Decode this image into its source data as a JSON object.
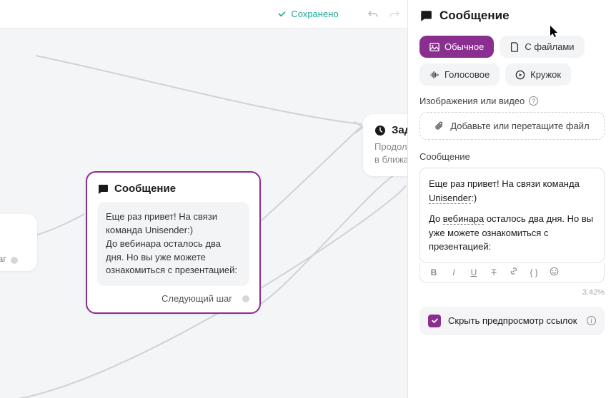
{
  "topbar": {
    "save_status": "Сохранено"
  },
  "canvas": {
    "left_node": "й шаг",
    "message_card": {
      "title": "Сообщение",
      "body_line1": "Еще раз привет! На связи команда Unisender:)",
      "body_line2": "До вебинара осталось два дня. Но вы уже можете ознакомиться с презентацией:",
      "next_step": "Следующий шаг"
    },
    "delay_card": {
      "title": "Зад",
      "sub1": "Продолж",
      "sub2": "в ближа"
    }
  },
  "sidebar": {
    "title": "Сообщение",
    "tabs": {
      "regular": "Обычное",
      "files": "С файлами",
      "voice": "Голосовое",
      "circle": "Кружок"
    },
    "media_label": "Изображения или видео",
    "upload_label": "Добавьте или перетащите файл",
    "message_label": "Сообщение",
    "editor": {
      "p1_prefix": "Еще раз привет! На связи команда ",
      "p1_dotted": "Unisender",
      "p1_suffix": ":)",
      "p2_prefix": "До ",
      "p2_dotted": "вебинара",
      "p2_suffix": " осталось два дня. Но вы уже можете ознакомиться с презентацией:"
    },
    "char_count": "3.42%",
    "hide_preview": "Скрыть предпросмотр ссылок"
  }
}
